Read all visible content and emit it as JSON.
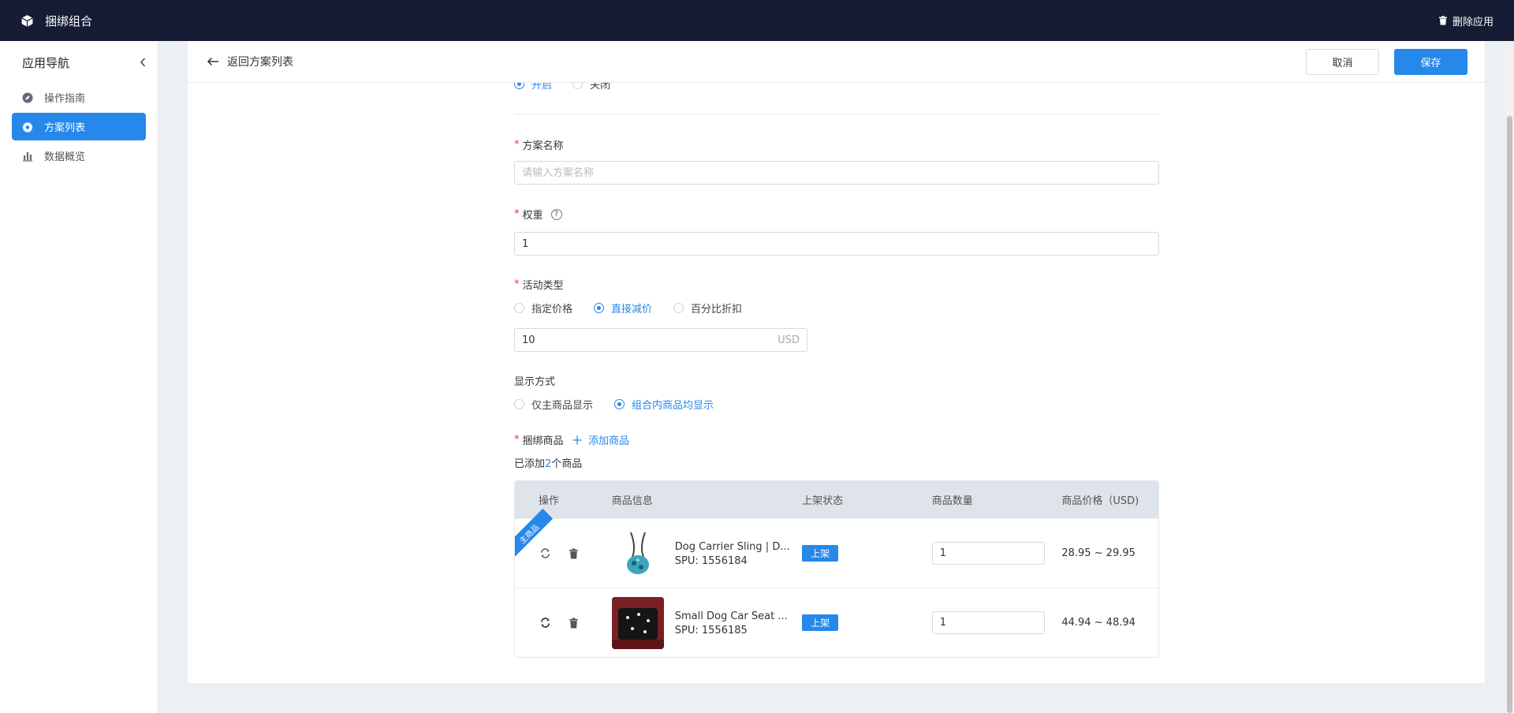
{
  "topbar": {
    "title": "捆绑组合",
    "delete_app": "删除应用"
  },
  "sidebar": {
    "title": "应用导航",
    "items": [
      {
        "label": "操作指南",
        "icon": "navigation-icon"
      },
      {
        "label": "方案列表",
        "icon": "gear-icon",
        "active": true
      },
      {
        "label": "数据概览",
        "icon": "bar-chart-icon"
      }
    ]
  },
  "header": {
    "back_label": "返回方案列表",
    "cancel_label": "取消",
    "save_label": "保存"
  },
  "status": {
    "on_label": "开启",
    "off_label": "关闭",
    "selected": "开启"
  },
  "plan_name": {
    "label": "方案名称",
    "placeholder": "请输入方案名称",
    "value": ""
  },
  "weight": {
    "label": "权重",
    "value": "1"
  },
  "activity_type": {
    "label": "活动类型",
    "options": [
      "指定价格",
      "直接减价",
      "百分比折扣"
    ],
    "selected": "直接减价",
    "amount": "10",
    "unit": "USD"
  },
  "display_mode": {
    "label": "显示方式",
    "options": [
      "仅主商品显示",
      "组合内商品均显示"
    ],
    "selected": "组合内商品均显示"
  },
  "bundle": {
    "label": "捆绑商品",
    "add_label": "添加商品",
    "added_prefix": "已添加",
    "added_count": "2",
    "added_suffix": "个商品"
  },
  "table": {
    "headers": [
      "操作",
      "商品信息",
      "上架状态",
      "商品数量",
      "商品价格（USD)"
    ],
    "main_ribbon": "主商品",
    "rows": [
      {
        "name": "Dog Carrier Sling | D...",
        "spu": "SPU: 1556184",
        "status": "上架",
        "qty": "1",
        "price": "28.95 ~ 29.95",
        "main": true
      },
      {
        "name": "Small Dog Car Seat ...",
        "spu": "SPU: 1556185",
        "status": "上架",
        "qty": "1",
        "price": "44.94 ~ 48.94",
        "main": false
      }
    ]
  },
  "colors": {
    "topbar": "#151c33",
    "accent": "#2688eb",
    "required": "#e53935"
  }
}
